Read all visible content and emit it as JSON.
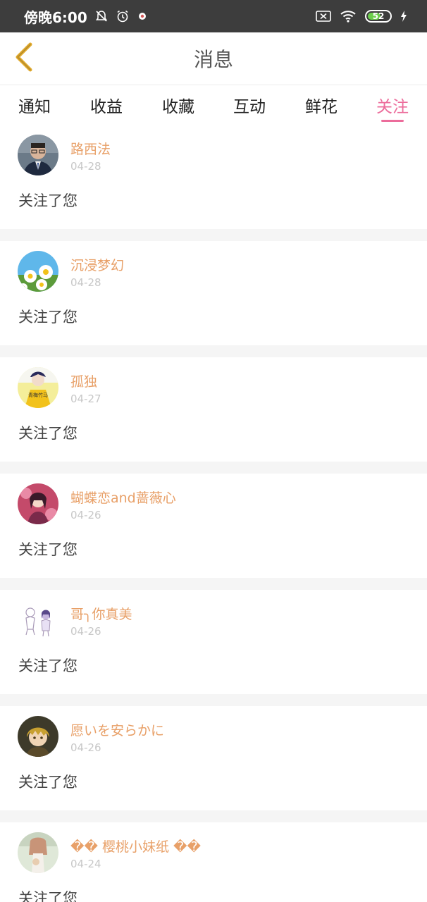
{
  "status_bar": {
    "time": "傍晚6:00",
    "battery": "52",
    "icons": [
      "bell-off-icon",
      "alarm-icon",
      "app-notification-icon",
      "sim-x-icon",
      "wifi-icon",
      "battery-icon",
      "charging-icon"
    ]
  },
  "header": {
    "title": "消息",
    "back_icon": "chevron-left-icon",
    "back_color": "#e0a92c"
  },
  "tabs": [
    {
      "label": "通知",
      "active": false
    },
    {
      "label": "收益",
      "active": false
    },
    {
      "label": "收藏",
      "active": false
    },
    {
      "label": "互动",
      "active": false
    },
    {
      "label": "鲜花",
      "active": false
    },
    {
      "label": "关注",
      "active": true
    }
  ],
  "colors": {
    "accent": "#ec6c9b",
    "username": "#e8a068",
    "date": "#c7c7c7"
  },
  "messages": [
    {
      "username": "路西法",
      "date": "04-28",
      "action": "关注了您"
    },
    {
      "username": "沉浸梦幻",
      "date": "04-28",
      "action": "关注了您"
    },
    {
      "username": "孤独",
      "date": "04-27",
      "action": "关注了您"
    },
    {
      "username": "蝴蝶恋and蔷薇心",
      "date": "04-26",
      "action": "关注了您"
    },
    {
      "username": "哥╮你真美",
      "date": "04-26",
      "action": "关注了您"
    },
    {
      "username": "愿いを安らかに",
      "date": "04-26",
      "action": "关注了您"
    },
    {
      "username": "�� 樱桃小妹纸 ��",
      "date": "04-24",
      "action": "关注了您"
    }
  ]
}
